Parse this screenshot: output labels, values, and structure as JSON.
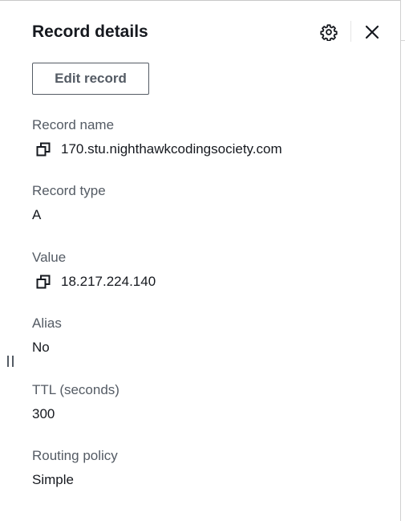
{
  "panel": {
    "title": "Record details",
    "edit_button_label": "Edit record",
    "settings_icon": "gear-icon",
    "close_icon": "close-icon"
  },
  "fields": [
    {
      "label": "Record name",
      "value": "170.stu.nighthawkcodingsociety.com",
      "copyable": true
    },
    {
      "label": "Record type",
      "value": "A",
      "copyable": false
    },
    {
      "label": "Value",
      "value": "18.217.224.140",
      "copyable": true
    },
    {
      "label": "Alias",
      "value": "No",
      "copyable": false
    },
    {
      "label": "TTL (seconds)",
      "value": "300",
      "copyable": false
    },
    {
      "label": "Routing policy",
      "value": "Simple",
      "copyable": false
    }
  ],
  "colors": {
    "text_primary": "#16191f",
    "text_secondary": "#545b64",
    "border": "#545b64"
  }
}
